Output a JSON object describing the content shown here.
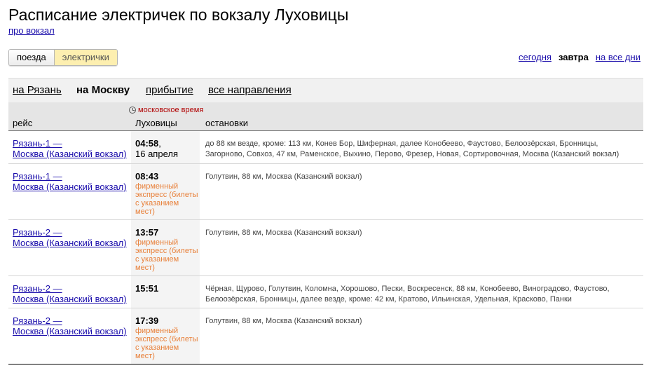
{
  "page": {
    "title": "Расписание электричек по вокзалу Луховицы",
    "about_link": "про вокзал"
  },
  "mode_tabs": [
    {
      "label": "поезда",
      "active": false
    },
    {
      "label": "электрички",
      "active": true
    }
  ],
  "date_nav": {
    "today": "сегодня",
    "tomorrow": "завтра",
    "all_days": "на все дни",
    "selected": "завтра"
  },
  "directions": [
    {
      "label": "на Рязань",
      "selected": false
    },
    {
      "label": "на Москву",
      "selected": true
    },
    {
      "label": "прибытие",
      "selected": false
    },
    {
      "label": "все направления",
      "selected": false
    }
  ],
  "table": {
    "timezone_note": "московское время",
    "headers": {
      "route": "рейс",
      "station": "Луховицы",
      "stops": "остановки"
    },
    "rows": [
      {
        "route_from": "Рязань-1 —",
        "route_to": "Москва (Казанский вокзал)",
        "time": "04:58",
        "time_suffix": ",",
        "date": "16 апреля",
        "note": "",
        "stops": "до 88 км везде, кроме: 113 км, Конев Бор, Шиферная, далее Конобеево, Фаустово, Белоозёрская, Бронницы, Загорново, Совхоз, 47 км, Раменское, Выхино, Перово, Фрезер, Новая, Сортировочная, Москва (Казанский вокзал)"
      },
      {
        "route_from": "Рязань-1 —",
        "route_to": "Москва (Казанский вокзал)",
        "time": "08:43",
        "time_suffix": "",
        "date": "",
        "note": "фирменный экспресс (билеты с указанием мест)",
        "stops": "Голутвин, 88 км, Москва (Казанский вокзал)"
      },
      {
        "route_from": "Рязань-2 —",
        "route_to": "Москва (Казанский вокзал)",
        "time": "13:57",
        "time_suffix": "",
        "date": "",
        "note": "фирменный экспресс (билеты с указанием мест)",
        "stops": "Голутвин, 88 км, Москва (Казанский вокзал)"
      },
      {
        "route_from": "Рязань-2 —",
        "route_to": "Москва (Казанский вокзал)",
        "time": "15:51",
        "time_suffix": "",
        "date": "",
        "note": "",
        "stops": "Чёрная, Щурово, Голутвин, Коломна, Хорошово, Пески, Воскресенск, 88 км, Конобеево, Виноградово, Фаустово, Белоозёрская, Бронницы, далее везде, кроме: 42 км, Кратово, Ильинская, Удельная, Красково, Панки"
      },
      {
        "route_from": "Рязань-2 —",
        "route_to": "Москва (Казанский вокзал)",
        "time": "17:39",
        "time_suffix": "",
        "date": "",
        "note": "фирменный экспресс (билеты с указанием мест)",
        "stops": "Голутвин, 88 км, Москва (Казанский вокзал)"
      }
    ]
  },
  "colors": {
    "link": "#1a0dab",
    "active_tab": "#fdefb0",
    "note": "#e8803a",
    "timezone": "#b00000"
  }
}
